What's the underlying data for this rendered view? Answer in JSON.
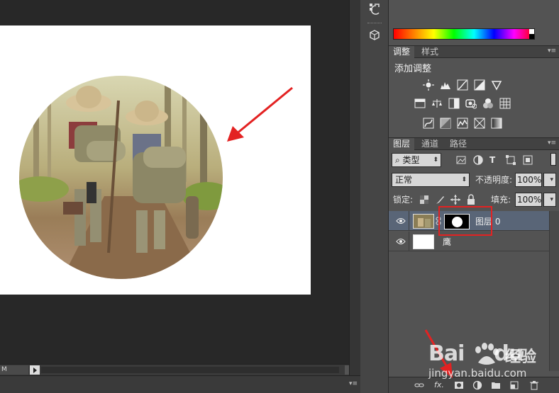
{
  "canvas": {
    "zoom_text": "M"
  },
  "adjustments_panel": {
    "tabs": [
      {
        "label": "调整",
        "active": true
      },
      {
        "label": "样式",
        "active": false
      }
    ],
    "title": "添加调整"
  },
  "layers_panel": {
    "tabs": [
      {
        "label": "图层",
        "active": true
      },
      {
        "label": "通道",
        "active": false
      },
      {
        "label": "路径",
        "active": false
      }
    ],
    "filter": {
      "icon": "search-icon",
      "value": "类型"
    },
    "blend_mode": "正常",
    "opacity_label": "不透明度:",
    "opacity_value": "100%",
    "lock_label": "锁定:",
    "fill_label": "填充:",
    "fill_value": "100%",
    "layers": [
      {
        "name": "图层 0",
        "selected": true,
        "has_mask": true,
        "visible": true
      },
      {
        "name": "鹰",
        "selected": false,
        "has_mask": false,
        "visible": true
      }
    ],
    "footer_icons": [
      "link-icon",
      "fx-icon",
      "mask-icon",
      "adjustment-icon",
      "folder-icon",
      "new-layer-icon",
      "trash-icon"
    ]
  },
  "watermark": {
    "brand": "Bai",
    "brand_tail": "du",
    "cn": "经验",
    "url": "jingyan.baidu.com"
  },
  "colors": {
    "annotation_red": "#e32222",
    "panel_bg": "#535353",
    "selected_row": "#596577"
  }
}
